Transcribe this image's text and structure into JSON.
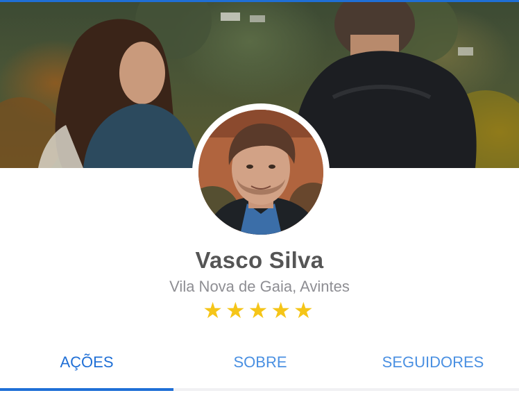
{
  "profile": {
    "name": "Vasco Silva",
    "location": "Vila Nova de Gaia, Avintes",
    "rating": 5,
    "rating_max": 5,
    "stars_text": "★★★★★"
  },
  "tabs": [
    {
      "label": "AÇÕES",
      "active": true
    },
    {
      "label": "SOBRE",
      "active": false
    },
    {
      "label": "SEGUIDORES",
      "active": false
    }
  ],
  "colors": {
    "accent": "#1f6fd6",
    "tab_text": "#4a90e2",
    "star": "#f5c518",
    "name_text": "#555555",
    "location_text": "#8e8e93"
  },
  "icons": [
    "star-icon"
  ]
}
